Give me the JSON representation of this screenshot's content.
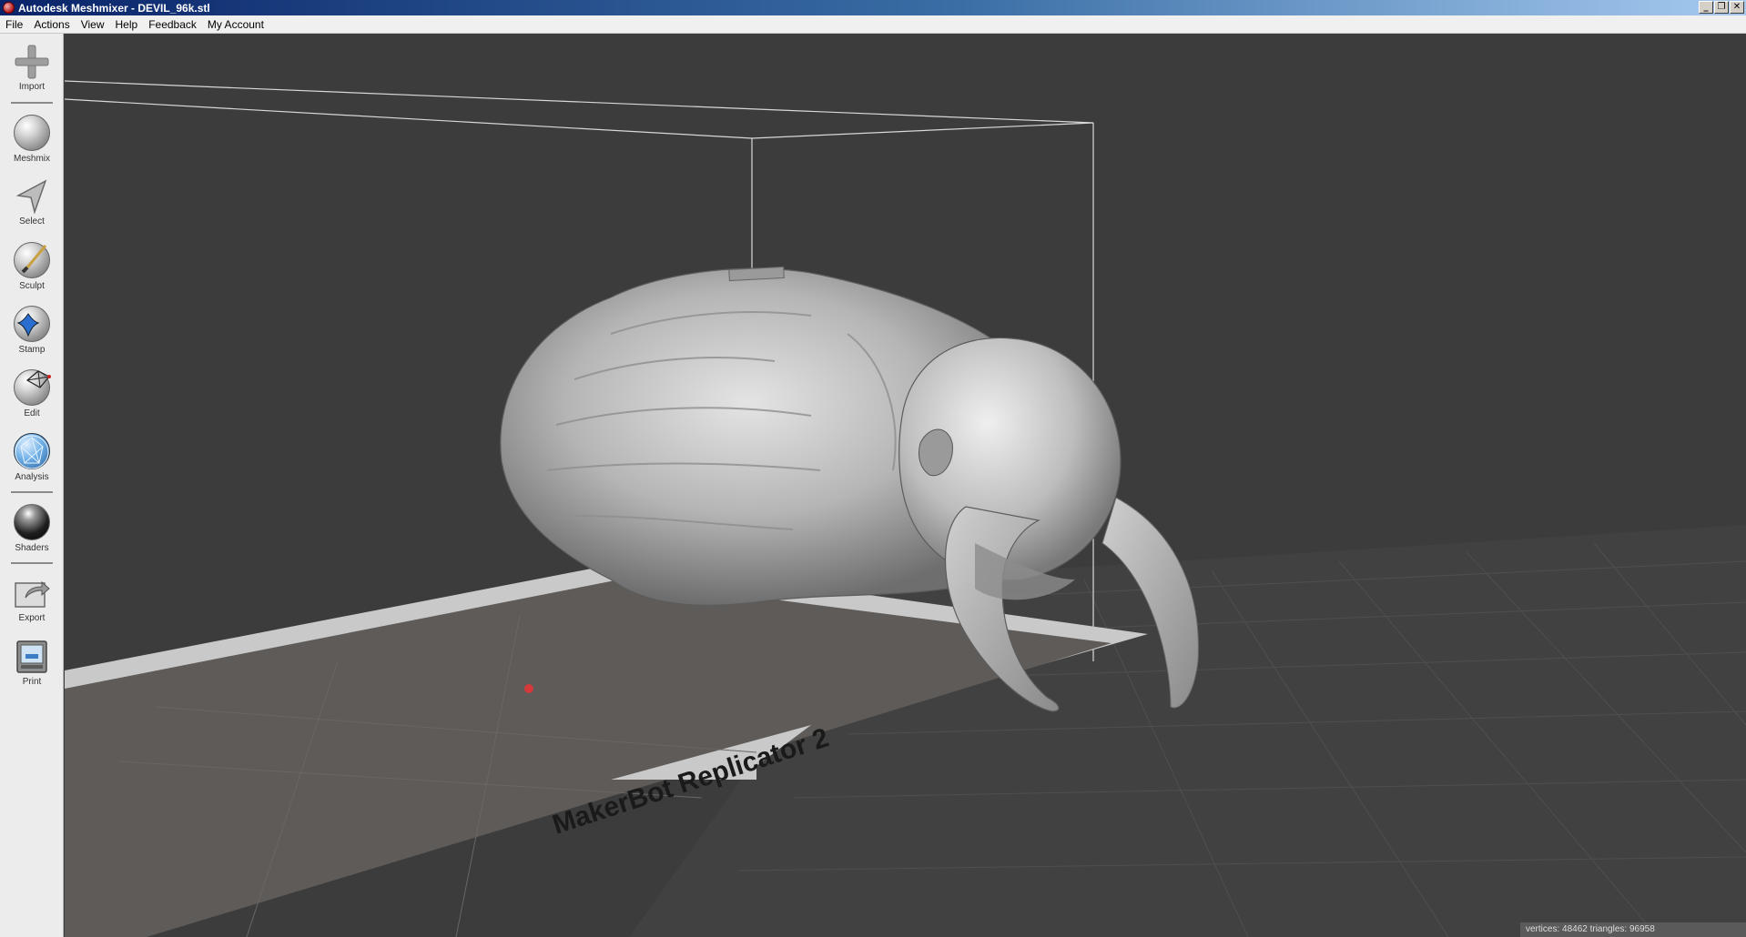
{
  "window": {
    "title": "Autodesk Meshmixer - DEVIL_96k.stl",
    "controls": {
      "minimize": "_",
      "restore": "❐",
      "close": "✕"
    }
  },
  "menu": [
    "File",
    "Actions",
    "View",
    "Help",
    "Feedback",
    "My Account"
  ],
  "toolbar": {
    "import": "Import",
    "meshmix": "Meshmix",
    "select": "Select",
    "sculpt": "Sculpt",
    "stamp": "Stamp",
    "edit": "Edit",
    "analysis": "Analysis",
    "shaders": "Shaders",
    "export": "Export",
    "print": "Print"
  },
  "viewport": {
    "printer_label": "MakerBot Replicator 2",
    "background_color": "#3c3c3c",
    "bed_color": "#5e5b58",
    "bed_border_color": "#c9c9c9",
    "model_color": "#bdbdbd"
  },
  "status": "vertices: 48462 triangles: 96958"
}
